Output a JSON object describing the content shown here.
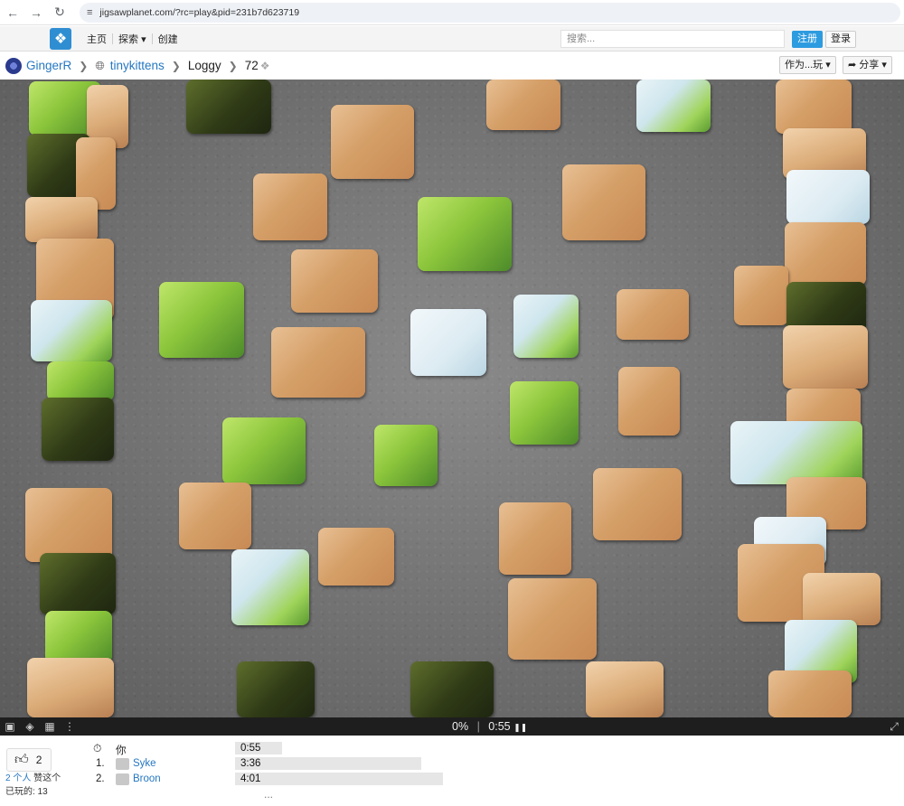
{
  "browser": {
    "url": "jigsawplanet.com/?rc=play&pid=231b7d623719"
  },
  "header": {
    "menu": [
      "主页",
      "探索",
      "创建"
    ],
    "search_placeholder": "搜索...",
    "register_label": "注册",
    "login_label": "登录"
  },
  "breadcrumb": {
    "user": "GingerR",
    "folder": "tinykittens",
    "puzzle": "Loggy",
    "pieces": "72"
  },
  "actions": {
    "play_as": "作为...玩",
    "share": "分享"
  },
  "status": {
    "progress": "0%",
    "separator": "|",
    "timer": "0:55"
  },
  "likes": {
    "count": "2",
    "people": "2 个人",
    "like_text": "赞这个",
    "played": "已玩的: 13"
  },
  "leaderboard": {
    "you_label": "你",
    "you_time": "0:55",
    "entries": [
      {
        "rank": "1.",
        "name": "Syke",
        "time": "3:36"
      },
      {
        "rank": "2.",
        "name": "Broon",
        "time": "4:01"
      }
    ],
    "more": "..."
  }
}
